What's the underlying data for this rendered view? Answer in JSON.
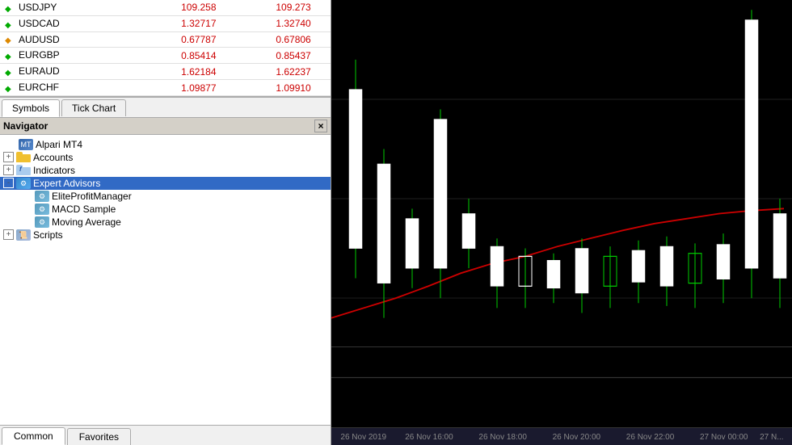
{
  "symbols": {
    "rows": [
      {
        "name": "USDJPY",
        "bid": "109.258",
        "ask": "109.273",
        "icon": "green"
      },
      {
        "name": "USDCAD",
        "bid": "1.32717",
        "ask": "1.32740",
        "icon": "green"
      },
      {
        "name": "AUDUSD",
        "bid": "0.67787",
        "ask": "0.67806",
        "icon": "orange"
      },
      {
        "name": "EURGBP",
        "bid": "0.85414",
        "ask": "0.85437",
        "icon": "green"
      },
      {
        "name": "EURAUD",
        "bid": "1.62184",
        "ask": "1.62237",
        "icon": "green"
      },
      {
        "name": "EURCHF",
        "bid": "1.09877",
        "ask": "1.09910",
        "icon": "green"
      }
    ]
  },
  "tabs": {
    "symbols_label": "Symbols",
    "tick_chart_label": "Tick Chart"
  },
  "navigator": {
    "title": "Navigator",
    "close_label": "×",
    "items": [
      {
        "id": "alpari",
        "label": "Alpari MT4",
        "indent": 0,
        "type": "server",
        "expand": null
      },
      {
        "id": "accounts",
        "label": "Accounts",
        "indent": 0,
        "type": "folder",
        "expand": "+"
      },
      {
        "id": "indicators",
        "label": "Indicators",
        "indent": 0,
        "type": "folder-f",
        "expand": "+"
      },
      {
        "id": "expert-advisors",
        "label": "Expert Advisors",
        "indent": 0,
        "type": "ea-folder",
        "expand": "-",
        "selected": true
      },
      {
        "id": "elite-profit",
        "label": "EliteProfitManager",
        "indent": 1,
        "type": "ea-item",
        "expand": null
      },
      {
        "id": "macd-sample",
        "label": "MACD Sample",
        "indent": 1,
        "type": "ea-item",
        "expand": null
      },
      {
        "id": "moving-average",
        "label": "Moving Average",
        "indent": 1,
        "type": "ea-item",
        "expand": null
      },
      {
        "id": "scripts",
        "label": "Scripts",
        "indent": 0,
        "type": "script-folder",
        "expand": "+"
      }
    ]
  },
  "bottom_tabs": {
    "common_label": "Common",
    "favorites_label": "Favorites"
  },
  "chart": {
    "time_labels": [
      {
        "text": "26 Nov 2019",
        "left_pct": 2
      },
      {
        "text": "26 Nov 16:00",
        "left_pct": 16
      },
      {
        "text": "26 Nov 18:00",
        "left_pct": 32
      },
      {
        "text": "26 Nov 20:00",
        "left_pct": 48
      },
      {
        "text": "26 Nov 22:00",
        "left_pct": 64
      },
      {
        "text": "27 Nov 00:00",
        "left_pct": 80
      },
      {
        "text": "27 N...",
        "left_pct": 93
      }
    ]
  }
}
